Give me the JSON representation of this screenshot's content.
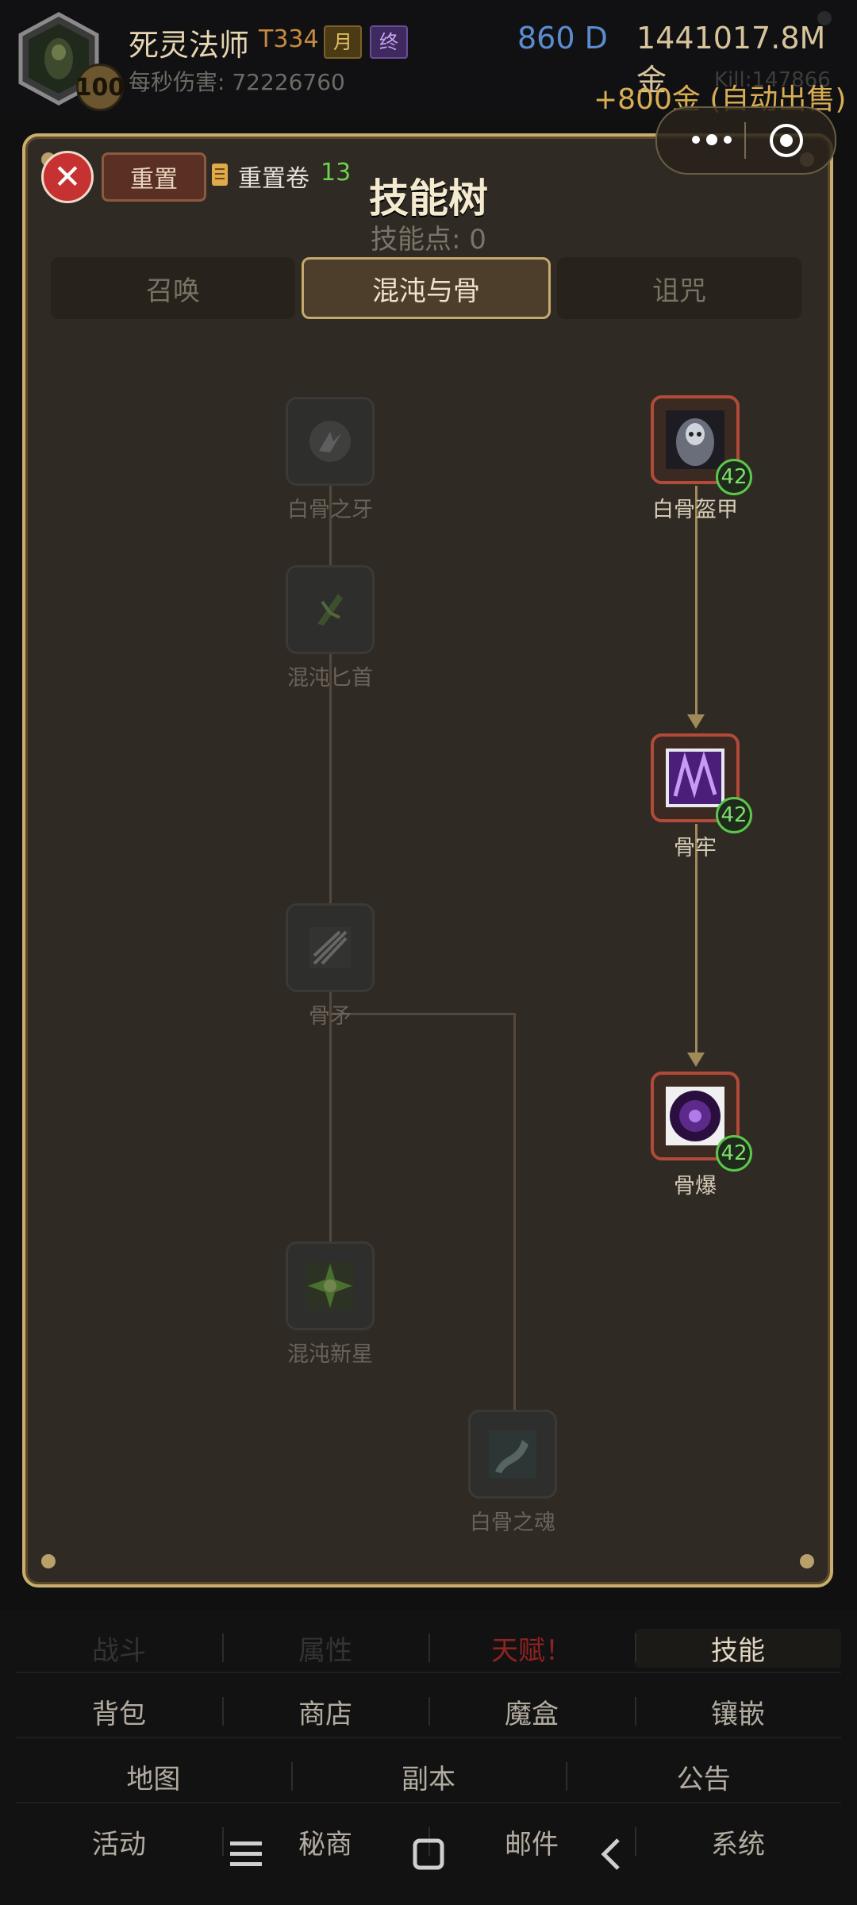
{
  "header": {
    "class_name": "死灵法师",
    "tier": "T334",
    "badge_month": "月",
    "badge_end": "终",
    "level": "100",
    "dps": "每秒伤害: 72226760",
    "diamonds": "860 D",
    "gold": "1441017.8M 金",
    "gold_income": "+800金 (自动出售)",
    "kills": "Kill:147866"
  },
  "dialog": {
    "title": "技能树",
    "points": "技能点: 0",
    "reset_label": "重置",
    "scroll_label": "重置卷",
    "scroll_count": "13",
    "close_icon": "close-icon",
    "tabs": [
      "召唤",
      "混沌与骨",
      "诅咒"
    ],
    "active_tab": "混沌与骨"
  },
  "skills": [
    {
      "name": "白骨之牙",
      "learned": false,
      "level": null
    },
    {
      "name": "混沌匕首",
      "learned": false,
      "level": null
    },
    {
      "name": "骨矛",
      "learned": false,
      "level": null
    },
    {
      "name": "混沌新星",
      "learned": false,
      "level": null
    },
    {
      "name": "白骨之魂",
      "learned": false,
      "level": null
    },
    {
      "name": "白骨盔甲",
      "learned": true,
      "level": "42"
    },
    {
      "name": "骨牢",
      "learned": true,
      "level": "42"
    },
    {
      "name": "骨爆",
      "learned": true,
      "level": "42"
    }
  ],
  "nav": {
    "row1": [
      "战斗",
      "属性",
      "天赋！",
      "技能"
    ],
    "row2": [
      "背包",
      "商店",
      "魔盒",
      "镶嵌"
    ],
    "row3": [
      "地图",
      "副本",
      "公告"
    ],
    "row4": [
      "活动",
      "秘商",
      "邮件",
      "系统"
    ]
  },
  "colors": {
    "frame_gold": "#c9ad6e",
    "learned_border": "#b24a3a",
    "level_green": "#5ac84a",
    "alert_red": "#8f2222"
  }
}
